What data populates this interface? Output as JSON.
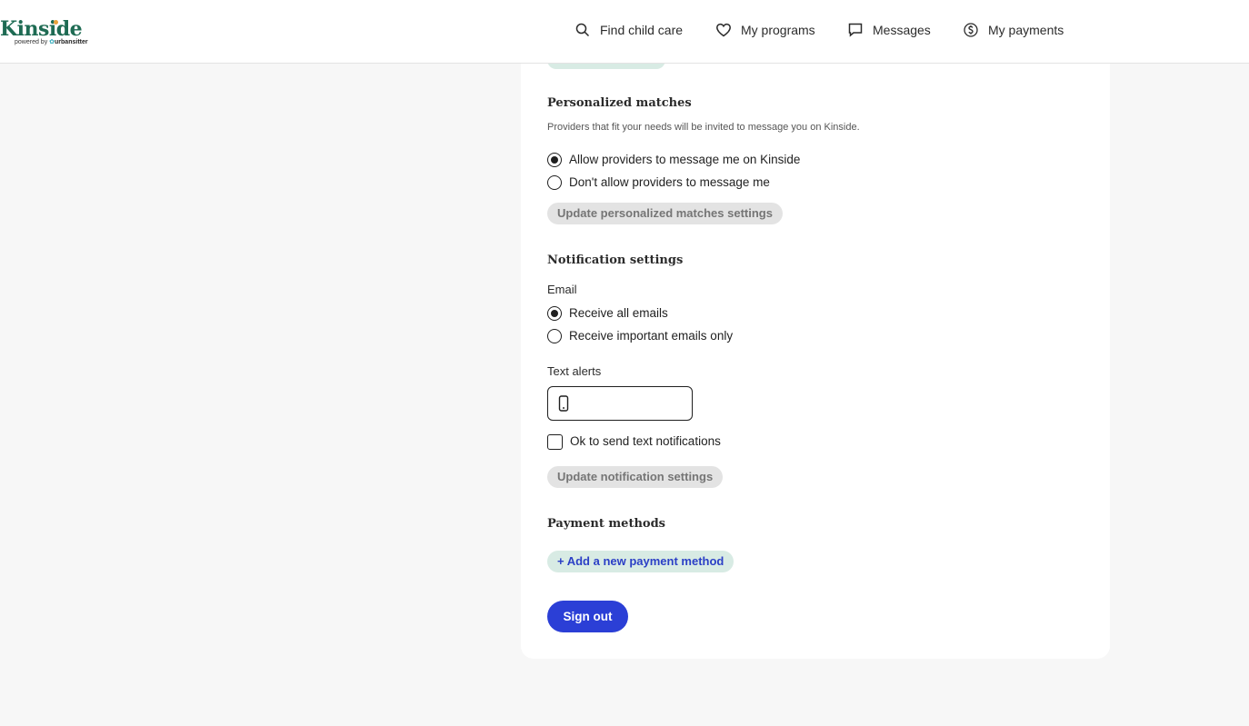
{
  "brand": {
    "name": "Kinside",
    "tagline_prefix": "powered by",
    "tagline_brand": "urbansitter"
  },
  "nav": {
    "items": [
      {
        "label": "Find child care",
        "icon": "search-icon"
      },
      {
        "label": "My programs",
        "icon": "heart-icon"
      },
      {
        "label": "Messages",
        "icon": "chat-bubble-icon"
      },
      {
        "label": "My payments",
        "icon": "dollar-circle-icon"
      }
    ]
  },
  "personalized_matches": {
    "title": "Personalized matches",
    "hint": "Providers that fit your needs will be invited to message you on Kinside.",
    "options": [
      {
        "label": "Allow providers to message me on Kinside",
        "selected": true
      },
      {
        "label": "Don't allow providers to message me",
        "selected": false
      }
    ],
    "update_button": "Update personalized matches settings"
  },
  "notifications": {
    "title": "Notification settings",
    "email_label": "Email",
    "email_options": [
      {
        "label": "Receive all emails",
        "selected": true
      },
      {
        "label": "Receive important emails only",
        "selected": false
      }
    ],
    "text_alerts_label": "Text alerts",
    "phone_value": "",
    "sms_consent_label": "Ok to send text notifications",
    "sms_consent_checked": false,
    "update_button": "Update notification settings"
  },
  "payment_methods": {
    "title": "Payment methods",
    "add_button": "+ Add a new payment method"
  },
  "sign_out": "Sign out",
  "colors": {
    "brand_green": "#1e6b53",
    "accent_blue": "#2b3fd6",
    "mint": "#d8ebe4",
    "disabled_gray": "#e3e3e3"
  }
}
